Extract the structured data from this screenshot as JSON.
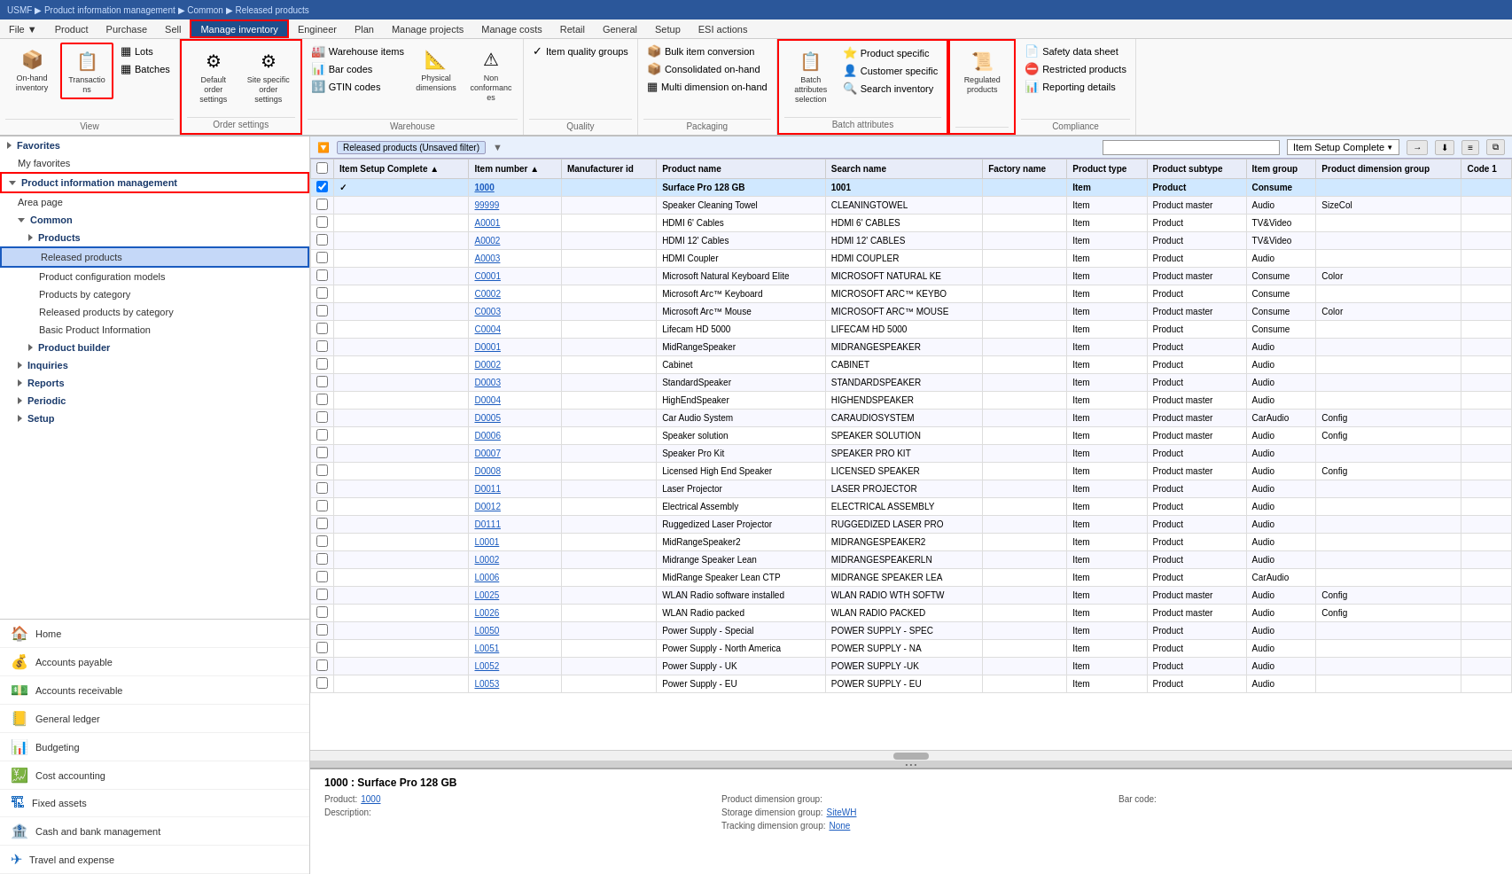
{
  "topbar": {
    "breadcrumb": "USMF ▶ Product information management ▶ Common ▶ Released products"
  },
  "menubar": {
    "items": [
      {
        "label": "File",
        "active": false
      },
      {
        "label": "Product",
        "active": false
      },
      {
        "label": "Purchase",
        "active": false
      },
      {
        "label": "Sell",
        "active": false
      },
      {
        "label": "Manage inventory",
        "active": true,
        "highlighted": true
      },
      {
        "label": "Engineer",
        "active": false
      },
      {
        "label": "Plan",
        "active": false
      },
      {
        "label": "Manage projects",
        "active": false
      },
      {
        "label": "Manage costs",
        "active": false
      },
      {
        "label": "Retail",
        "active": false
      },
      {
        "label": "General",
        "active": false
      },
      {
        "label": "Setup",
        "active": false
      },
      {
        "label": "ESI actions",
        "active": false
      }
    ]
  },
  "ribbon": {
    "sections": [
      {
        "label": "View",
        "buttons": [
          {
            "icon": "📦",
            "label": "On-hand inventory",
            "large": true,
            "highlighted": false
          },
          {
            "icon": "📋",
            "label": "Transactions",
            "large": true,
            "highlighted": true
          }
        ],
        "smallGroups": [
          [
            {
              "icon": "▦",
              "label": "Lots"
            },
            {
              "icon": "▦",
              "label": "Batches"
            }
          ]
        ]
      },
      {
        "label": "Order settings",
        "buttons": [
          {
            "icon": "⚙",
            "label": "Default order settings",
            "large": true,
            "highlighted": true
          },
          {
            "icon": "⚙",
            "label": "Site specific order settings",
            "large": true,
            "highlighted": true
          }
        ]
      },
      {
        "label": "Warehouse",
        "smallButtons": [
          {
            "icon": "🏭",
            "label": "Warehouse items"
          },
          {
            "icon": "📊",
            "label": "Bar codes"
          },
          {
            "icon": "🔢",
            "label": "GTIN codes"
          },
          {
            "icon": "📐",
            "label": "Physical dimensions"
          }
        ],
        "extraButtons": [
          {
            "icon": "⚠",
            "label": "Non conformances"
          }
        ]
      },
      {
        "label": "Quality",
        "smallButtons": [
          {
            "icon": "✓",
            "label": "Item quality groups"
          }
        ]
      },
      {
        "label": "Packaging",
        "smallButtons": [
          {
            "icon": "📦",
            "label": "Bulk item conversion"
          },
          {
            "icon": "📦",
            "label": "Consolidated on-hand"
          },
          {
            "icon": "▦",
            "label": "Multi dimension on-hand"
          }
        ]
      },
      {
        "label": "Batch attributes",
        "buttons": [
          {
            "icon": "📋",
            "label": "Batch attributes selection",
            "large": true,
            "highlighted": true
          }
        ],
        "smallButtons": [
          {
            "icon": "⭐",
            "label": "Product specific"
          },
          {
            "icon": "👤",
            "label": "Customer specific"
          },
          {
            "icon": "🔍",
            "label": "Search inventory"
          }
        ]
      },
      {
        "label": "",
        "buttons": [
          {
            "icon": "📜",
            "label": "Regulated products",
            "large": true,
            "highlighted": true
          }
        ]
      },
      {
        "label": "Compliance",
        "smallButtons": [
          {
            "icon": "📄",
            "label": "Safety data sheet"
          },
          {
            "icon": "⛔",
            "label": "Restricted products"
          },
          {
            "icon": "📊",
            "label": "Reporting details"
          }
        ]
      }
    ]
  },
  "sidebar": {
    "favorites_label": "Favorites",
    "my_favorites_label": "My favorites",
    "pim_label": "Product information management",
    "area_page_label": "Area page",
    "common_label": "Common",
    "products_label": "Products",
    "released_products_label": "Released products",
    "product_config_label": "Product configuration models",
    "products_by_category_label": "Products by category",
    "released_by_category_label": "Released products by category",
    "basic_product_label": "Basic Product Information",
    "product_builder_label": "Product builder",
    "inquiries_label": "Inquiries",
    "reports_label": "Reports",
    "periodic_label": "Periodic",
    "setup_label": "Setup",
    "bottom_items": [
      {
        "icon": "🏠",
        "label": "Home"
      },
      {
        "icon": "💰",
        "label": "Accounts payable"
      },
      {
        "icon": "💵",
        "label": "Accounts receivable"
      },
      {
        "icon": "📒",
        "label": "General ledger"
      },
      {
        "icon": "📊",
        "label": "Budgeting"
      },
      {
        "icon": "💹",
        "label": "Cost accounting"
      },
      {
        "icon": "🏗",
        "label": "Fixed assets"
      },
      {
        "icon": "🏦",
        "label": "Cash and bank management"
      },
      {
        "icon": "✈",
        "label": "Travel and expense"
      }
    ]
  },
  "grid": {
    "title": "Released products (Unsaved filter)",
    "status_filter_label": "Item Setup Complete",
    "columns": [
      "Item Setup Complete",
      "Item number",
      "Manufacturer id",
      "Product name",
      "Search name",
      "Factory name",
      "Product type",
      "Product subtype",
      "Item group",
      "Product dimension group",
      "Code 1"
    ],
    "rows": [
      {
        "setup": true,
        "item": "1000",
        "mfr": "",
        "name": "Surface Pro 128 GB",
        "search": "1001",
        "factory": "",
        "type": "Item",
        "subtype": "Product",
        "group": "Consume",
        "dim_group": "",
        "code": ""
      },
      {
        "setup": false,
        "item": "99999",
        "mfr": "",
        "name": "Speaker Cleaning Towel",
        "search": "CLEANINGTOWEL",
        "factory": "",
        "type": "Item",
        "subtype": "Product master",
        "group": "Audio",
        "dim_group": "SizeCol",
        "code": ""
      },
      {
        "setup": false,
        "item": "A0001",
        "mfr": "",
        "name": "HDMI 6' Cables",
        "search": "HDMI 6' CABLES",
        "factory": "",
        "type": "Item",
        "subtype": "Product",
        "group": "TV&Video",
        "dim_group": "",
        "code": ""
      },
      {
        "setup": false,
        "item": "A0002",
        "mfr": "",
        "name": "HDMI 12' Cables",
        "search": "HDMI 12' CABLES",
        "factory": "",
        "type": "Item",
        "subtype": "Product",
        "group": "TV&Video",
        "dim_group": "",
        "code": ""
      },
      {
        "setup": false,
        "item": "A0003",
        "mfr": "",
        "name": "HDMI Coupler",
        "search": "HDMI COUPLER",
        "factory": "",
        "type": "Item",
        "subtype": "Product",
        "group": "Audio",
        "dim_group": "",
        "code": ""
      },
      {
        "setup": false,
        "item": "C0001",
        "mfr": "",
        "name": "Microsoft Natural Keyboard Elite",
        "search": "MICROSOFT NATURAL KE",
        "factory": "",
        "type": "Item",
        "subtype": "Product master",
        "group": "Consume",
        "dim_group": "Color",
        "code": ""
      },
      {
        "setup": false,
        "item": "C0002",
        "mfr": "",
        "name": "Microsoft Arc™ Keyboard",
        "search": "MICROSOFT ARC™ KEYBO",
        "factory": "",
        "type": "Item",
        "subtype": "Product",
        "group": "Consume",
        "dim_group": "",
        "code": ""
      },
      {
        "setup": false,
        "item": "C0003",
        "mfr": "",
        "name": "Microsoft Arc™ Mouse",
        "search": "MICROSOFT ARC™ MOUSE",
        "factory": "",
        "type": "Item",
        "subtype": "Product master",
        "group": "Consume",
        "dim_group": "Color",
        "code": ""
      },
      {
        "setup": false,
        "item": "C0004",
        "mfr": "",
        "name": "Lifecam HD 5000",
        "search": "LIFECAM HD 5000",
        "factory": "",
        "type": "Item",
        "subtype": "Product",
        "group": "Consume",
        "dim_group": "",
        "code": ""
      },
      {
        "setup": false,
        "item": "D0001",
        "mfr": "",
        "name": "MidRangeSpeaker",
        "search": "MIDRANGESPEAKER",
        "factory": "",
        "type": "Item",
        "subtype": "Product",
        "group": "Audio",
        "dim_group": "",
        "code": ""
      },
      {
        "setup": false,
        "item": "D0002",
        "mfr": "",
        "name": "Cabinet",
        "search": "CABINET",
        "factory": "",
        "type": "Item",
        "subtype": "Product",
        "group": "Audio",
        "dim_group": "",
        "code": ""
      },
      {
        "setup": false,
        "item": "D0003",
        "mfr": "",
        "name": "StandardSpeaker",
        "search": "STANDARDSPEAKER",
        "factory": "",
        "type": "Item",
        "subtype": "Product",
        "group": "Audio",
        "dim_group": "",
        "code": ""
      },
      {
        "setup": false,
        "item": "D0004",
        "mfr": "",
        "name": "HighEndSpeaker",
        "search": "HIGHENDSPEAKER",
        "factory": "",
        "type": "Item",
        "subtype": "Product master",
        "group": "Audio",
        "dim_group": "",
        "code": ""
      },
      {
        "setup": false,
        "item": "D0005",
        "mfr": "",
        "name": "Car Audio System",
        "search": "CARAUDIOSYSTEM",
        "factory": "",
        "type": "Item",
        "subtype": "Product master",
        "group": "CarAudio",
        "dim_group": "Config",
        "code": ""
      },
      {
        "setup": false,
        "item": "D0006",
        "mfr": "",
        "name": "Speaker solution",
        "search": "SPEAKER SOLUTION",
        "factory": "",
        "type": "Item",
        "subtype": "Product master",
        "group": "Audio",
        "dim_group": "Config",
        "code": ""
      },
      {
        "setup": false,
        "item": "D0007",
        "mfr": "",
        "name": "Speaker Pro Kit",
        "search": "SPEAKER PRO KIT",
        "factory": "",
        "type": "Item",
        "subtype": "Product",
        "group": "Audio",
        "dim_group": "",
        "code": ""
      },
      {
        "setup": false,
        "item": "D0008",
        "mfr": "",
        "name": "Licensed High End Speaker",
        "search": "LICENSED SPEAKER",
        "factory": "",
        "type": "Item",
        "subtype": "Product master",
        "group": "Audio",
        "dim_group": "Config",
        "code": ""
      },
      {
        "setup": false,
        "item": "D0011",
        "mfr": "",
        "name": "Laser Projector",
        "search": "LASER PROJECTOR",
        "factory": "",
        "type": "Item",
        "subtype": "Product",
        "group": "Audio",
        "dim_group": "",
        "code": ""
      },
      {
        "setup": false,
        "item": "D0012",
        "mfr": "",
        "name": "Electrical Assembly",
        "search": "ELECTRICAL ASSEMBLY",
        "factory": "",
        "type": "Item",
        "subtype": "Product",
        "group": "Audio",
        "dim_group": "",
        "code": ""
      },
      {
        "setup": false,
        "item": "D0111",
        "mfr": "",
        "name": "Ruggedized Laser Projector",
        "search": "RUGGEDIZED LASER PRO",
        "factory": "",
        "type": "Item",
        "subtype": "Product",
        "group": "Audio",
        "dim_group": "",
        "code": ""
      },
      {
        "setup": false,
        "item": "L0001",
        "mfr": "",
        "name": "MidRangeSpeaker2",
        "search": "MIDRANGESPEAKER2",
        "factory": "",
        "type": "Item",
        "subtype": "Product",
        "group": "Audio",
        "dim_group": "",
        "code": ""
      },
      {
        "setup": false,
        "item": "L0002",
        "mfr": "",
        "name": "Midrange Speaker Lean",
        "search": "MIDRANGESPEAKERLN",
        "factory": "",
        "type": "Item",
        "subtype": "Product",
        "group": "Audio",
        "dim_group": "",
        "code": ""
      },
      {
        "setup": false,
        "item": "L0006",
        "mfr": "",
        "name": "MidRange Speaker Lean CTP",
        "search": "MIDRANGE SPEAKER LEA",
        "factory": "",
        "type": "Item",
        "subtype": "Product",
        "group": "CarAudio",
        "dim_group": "",
        "code": ""
      },
      {
        "setup": false,
        "item": "L0025",
        "mfr": "",
        "name": "WLAN Radio software installed",
        "search": "WLAN RADIO WTH SOFTW",
        "factory": "",
        "type": "Item",
        "subtype": "Product master",
        "group": "Audio",
        "dim_group": "Config",
        "code": ""
      },
      {
        "setup": false,
        "item": "L0026",
        "mfr": "",
        "name": "WLAN Radio packed",
        "search": "WLAN RADIO PACKED",
        "factory": "",
        "type": "Item",
        "subtype": "Product master",
        "group": "Audio",
        "dim_group": "Config",
        "code": ""
      },
      {
        "setup": false,
        "item": "L0050",
        "mfr": "",
        "name": "Power Supply - Special",
        "search": "POWER SUPPLY - SPEC",
        "factory": "",
        "type": "Item",
        "subtype": "Product",
        "group": "Audio",
        "dim_group": "",
        "code": ""
      },
      {
        "setup": false,
        "item": "L0051",
        "mfr": "",
        "name": "Power Supply - North America",
        "search": "POWER SUPPLY - NA",
        "factory": "",
        "type": "Item",
        "subtype": "Product",
        "group": "Audio",
        "dim_group": "",
        "code": ""
      },
      {
        "setup": false,
        "item": "L0052",
        "mfr": "",
        "name": "Power Supply - UK",
        "search": "POWER SUPPLY -UK",
        "factory": "",
        "type": "Item",
        "subtype": "Product",
        "group": "Audio",
        "dim_group": "",
        "code": ""
      },
      {
        "setup": false,
        "item": "L0053",
        "mfr": "",
        "name": "Power Supply - EU",
        "search": "POWER SUPPLY - EU",
        "factory": "",
        "type": "Item",
        "subtype": "Product",
        "group": "Audio",
        "dim_group": "",
        "code": ""
      }
    ]
  },
  "detail": {
    "title": "1000 : Surface Pro 128 GB",
    "product_label": "Product:",
    "product_value": "1000",
    "description_label": "Description:",
    "description_value": "",
    "dim_group_label": "Product dimension group:",
    "dim_group_value": "",
    "storage_label": "Storage dimension group:",
    "storage_value": "SiteWH",
    "tracking_label": "Tracking dimension group:",
    "tracking_value": "None",
    "barcode_label": "Bar code:",
    "barcode_value": ""
  }
}
